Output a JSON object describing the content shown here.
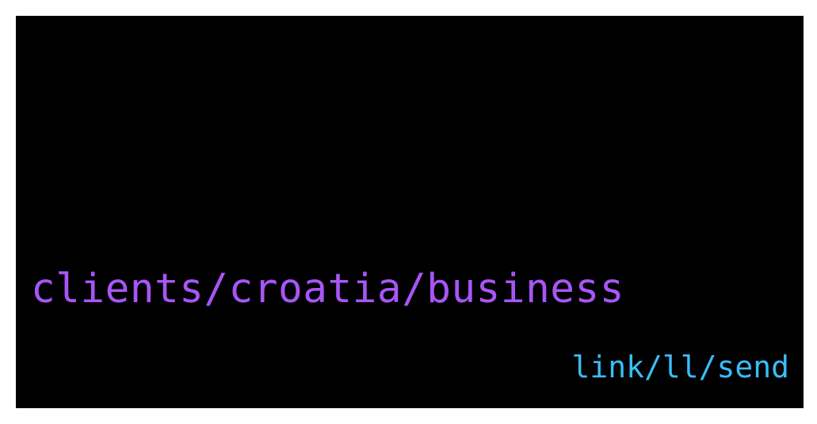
{
  "display": {
    "primary_path": "clients/croatia/business",
    "secondary_path": "link/ll/send"
  },
  "colors": {
    "background": "#000000",
    "page": "#ffffff",
    "primary_text": "#a855f7",
    "secondary_text": "#38bdf8"
  }
}
